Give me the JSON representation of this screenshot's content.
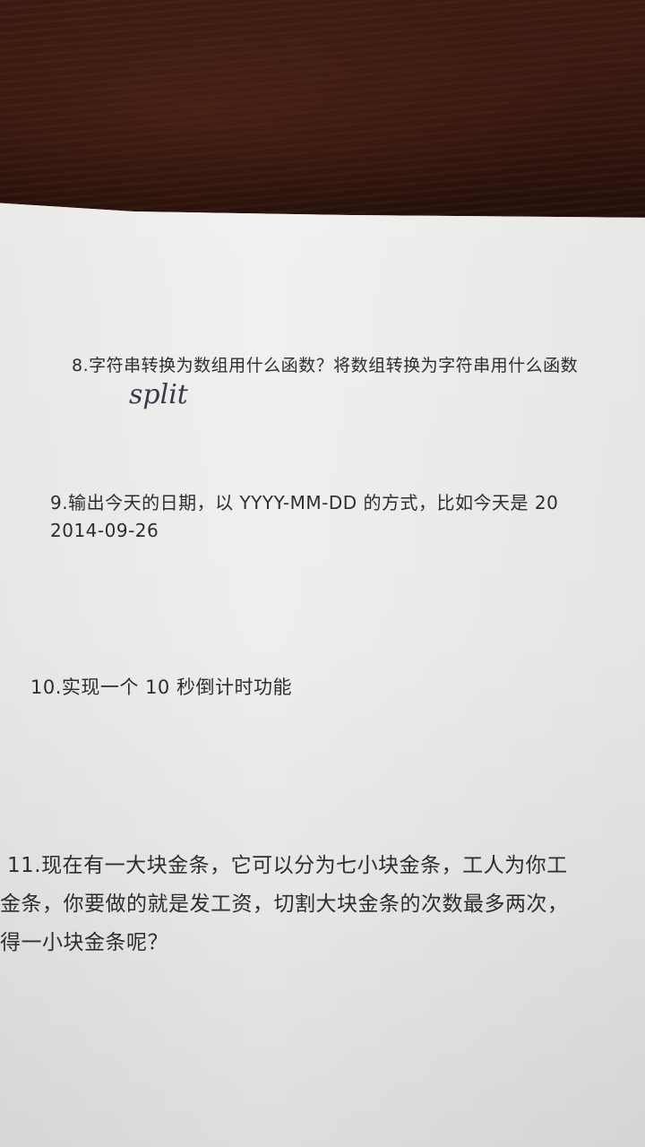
{
  "questions": {
    "q8": {
      "text": "8.字符串转换为数组用什么函数？将数组转换为字符串用什么函数",
      "handwritten_answer": "split"
    },
    "q9": {
      "line1": "9.输出今天的日期，以 YYYY-MM-DD 的方式，比如今天是 20",
      "line2": "2014-09-26"
    },
    "q10": {
      "text": "10.实现一个 10 秒倒计时功能"
    },
    "q11": {
      "line1": "11.现在有一大块金条，它可以分为七小块金条，工人为你工",
      "line2": "金条，你要做的就是发工资，切割大块金条的次数最多两次，",
      "line3": "得一小块金条呢？"
    }
  }
}
